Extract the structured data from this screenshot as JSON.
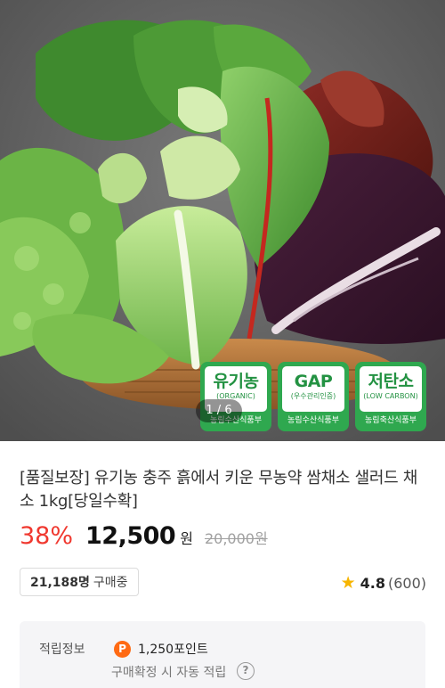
{
  "gallery": {
    "image_alt": "organic salad vegetables in a woven basket",
    "current_page": "1 / 6",
    "badges": [
      {
        "title": "유기농",
        "subtitle": "(ORGANIC)",
        "issuer": "농림수산식품부",
        "color": "#2fa84f"
      },
      {
        "title": "GAP",
        "subtitle": "(우수관리인증)",
        "issuer": "농림수산식품부",
        "color": "#2fa84f"
      },
      {
        "title": "저탄소",
        "subtitle": "(LOW CARBON)",
        "issuer": "농림축산식품부",
        "color": "#2fa84f"
      }
    ]
  },
  "product": {
    "title": "[품질보장] 유기농 충주 흙에서 키운 무농약 쌈채소 샐러드 채소 1kg[당일수확]",
    "discount_rate": "38%",
    "price": "12,500",
    "currency": "원",
    "original_price": "20,000원",
    "buyers_count": "21,188명",
    "buyers_label": "구매중",
    "rating_score": "4.8",
    "review_count": "(600)",
    "accent_color": "#f0382f",
    "star_color": "#f7b500"
  },
  "points": {
    "label": "적립정보",
    "icon": "P",
    "value": "1,250포인트",
    "note": "구매확정 시 자동 적립",
    "help_icon": "?",
    "icon_color": "#ff6a13"
  }
}
